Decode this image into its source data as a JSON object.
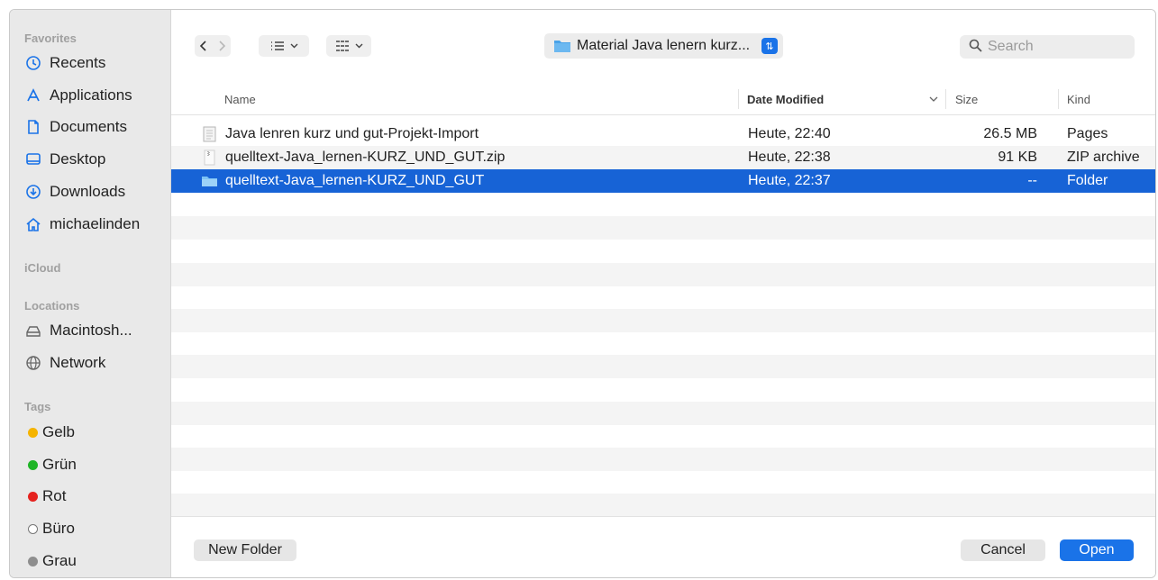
{
  "sidebar": {
    "favorites_heading": "Favorites",
    "icloud_heading": "iCloud",
    "locations_heading": "Locations",
    "tags_heading": "Tags",
    "favorites": [
      {
        "label": "Recents",
        "icon": "clock-icon"
      },
      {
        "label": "Applications",
        "icon": "applications-icon"
      },
      {
        "label": "Documents",
        "icon": "document-icon"
      },
      {
        "label": "Desktop",
        "icon": "desktop-icon"
      },
      {
        "label": "Downloads",
        "icon": "download-icon"
      },
      {
        "label": "michaelinden",
        "icon": "home-icon"
      }
    ],
    "locations": [
      {
        "label": "Macintosh...",
        "icon": "disk-icon"
      },
      {
        "label": "Network",
        "icon": "globe-icon"
      }
    ],
    "tags": [
      {
        "label": "Gelb",
        "color": "#f5b400"
      },
      {
        "label": "Grün",
        "color": "#1fb426"
      },
      {
        "label": "Rot",
        "color": "#e5221e"
      },
      {
        "label": "Büro",
        "color": "#ffffff"
      },
      {
        "label": "Grau",
        "color": "#8e8e8e"
      }
    ]
  },
  "toolbar": {
    "path_label": "Material Java lenern kurz...",
    "search_placeholder": "Search"
  },
  "columns": {
    "name": "Name",
    "date": "Date Modified",
    "size": "Size",
    "kind": "Kind"
  },
  "files": [
    {
      "name": "Java lenren kurz und gut-Projekt-Import",
      "date": "Heute, 22:40",
      "size": "26.5 MB",
      "kind": "Pages",
      "icon": "pages-document-icon"
    },
    {
      "name": "quelltext-Java_lernen-KURZ_UND_GUT.zip",
      "date": "Heute, 22:38",
      "size": "91 KB",
      "kind": "ZIP archive",
      "icon": "zip-file-icon"
    },
    {
      "name": "quelltext-Java_lernen-KURZ_UND_GUT",
      "date": "Heute, 22:37",
      "size": "--",
      "kind": "Folder",
      "icon": "folder-icon",
      "selected": true
    }
  ],
  "footer": {
    "new_folder": "New Folder",
    "cancel": "Cancel",
    "open": "Open"
  },
  "colors": {
    "accent": "#1a73e8",
    "selection": "#1763d6"
  }
}
